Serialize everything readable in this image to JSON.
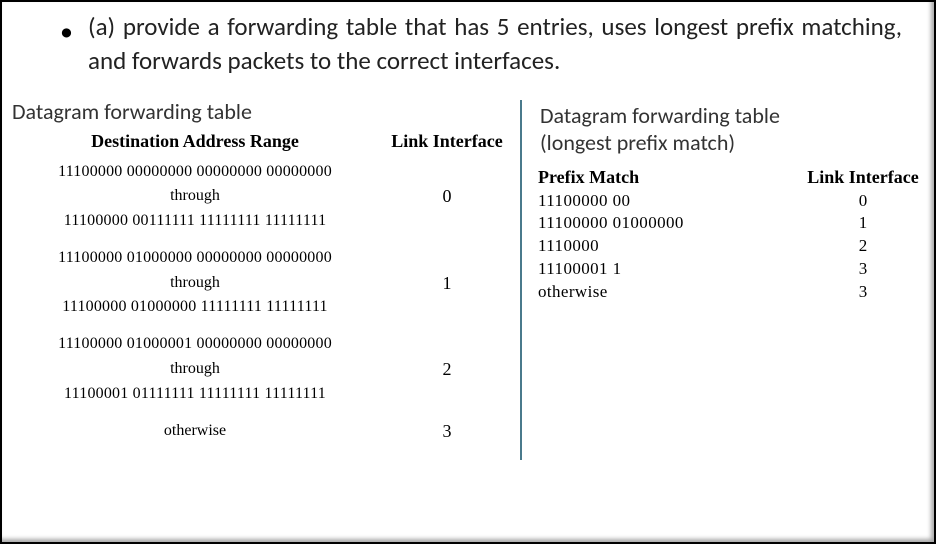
{
  "question": {
    "bullet": "•",
    "text": "(a)  provide a forwarding table that has 5 entries, uses longest prefix matching, and forwards packets to the correct interfaces."
  },
  "left_table": {
    "caption": "Datagram forwarding table",
    "header_addr": "Destination Address Range",
    "header_iface": "Link Interface",
    "through_word": "through",
    "rows": [
      {
        "from": "11100000 00000000 00000000 00000000",
        "to": "11100000 00111111 11111111 11111111",
        "iface": "0"
      },
      {
        "from": "11100000 01000000 00000000 00000000",
        "to": "11100000 01000000 11111111 11111111",
        "iface": "1"
      },
      {
        "from": "11100000 01000001 00000000 00000000",
        "to": "11100001 01111111 11111111 11111111",
        "iface": "2"
      }
    ],
    "otherwise_label": "otherwise",
    "otherwise_iface": "3"
  },
  "right_table": {
    "caption_line1": "Datagram forwarding table",
    "caption_line2": "(longest prefix match)",
    "header_prefix": "Prefix Match",
    "header_iface": "Link Interface",
    "rows": [
      {
        "prefix": "11100000  00",
        "iface": "0"
      },
      {
        "prefix": "11100000  01000000",
        "iface": "1"
      },
      {
        "prefix": "1110000",
        "iface": "2"
      },
      {
        "prefix": "11100001  1",
        "iface": "3"
      },
      {
        "prefix": "otherwise",
        "iface": "3"
      }
    ]
  }
}
